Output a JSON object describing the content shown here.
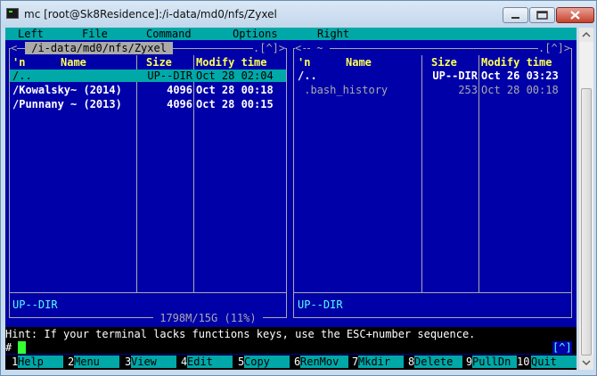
{
  "window": {
    "title": "mc [root@Sk8Residence]:/i-data/md0/nfs/Zyxel"
  },
  "menubar": [
    "Left",
    "File",
    "Command",
    "Options",
    "Right"
  ],
  "left_panel": {
    "path": " /i-data/md0/nfs/Zyxel ",
    "corner": ".[^]>",
    "columns": {
      "n": "'n",
      "name": "Name",
      "size": "Size",
      "modify": "Modify time"
    },
    "rows": [
      {
        "name": "/..",
        "size": "UP--DIR",
        "date": "Oct 28 02:04",
        "selected": true
      },
      {
        "name": "/Kowalsky~ (2014)",
        "size": "4096",
        "date": "Oct 28 00:18"
      },
      {
        "name": "/Punnany ~ (2013)",
        "size": "4096",
        "date": "Oct 28 00:15"
      }
    ],
    "status": "UP--DIR",
    "disk": " 1798M/15G (11%) "
  },
  "right_panel": {
    "path": " ~ ",
    "corner": ".[^]>",
    "columns": {
      "n": "'n",
      "name": "Name",
      "size": "Size",
      "modify": "Modify time"
    },
    "rows": [
      {
        "name": "/..",
        "size": "UP--DIR",
        "date": "Oct 26 03:23"
      },
      {
        "name": " .bash_history",
        "size": "253",
        "date": "Oct 28 00:18"
      }
    ],
    "status": "UP--DIR"
  },
  "hint": "Hint: If your terminal lacks functions keys, use the ESC+number sequence.",
  "prompt": {
    "symbol": "#",
    "corner": "[^]"
  },
  "function_keys": [
    {
      "num": "1",
      "label": "Help"
    },
    {
      "num": "2",
      "label": "Menu"
    },
    {
      "num": "3",
      "label": "View"
    },
    {
      "num": "4",
      "label": "Edit"
    },
    {
      "num": "5",
      "label": "Copy"
    },
    {
      "num": "6",
      "label": "RenMov"
    },
    {
      "num": "7",
      "label": "Mkdir"
    },
    {
      "num": "8",
      "label": "Delete"
    },
    {
      "num": "9",
      "label": "PullDn"
    },
    {
      "num": "10",
      "label": "Quit"
    }
  ],
  "colors": {
    "background": "#0000a8",
    "accent": "#00a8a8",
    "header": "#ffff55",
    "text": "#55ffff"
  },
  "icons": [
    "terminal-icon",
    "minimize-icon",
    "maximize-icon",
    "close-icon"
  ]
}
